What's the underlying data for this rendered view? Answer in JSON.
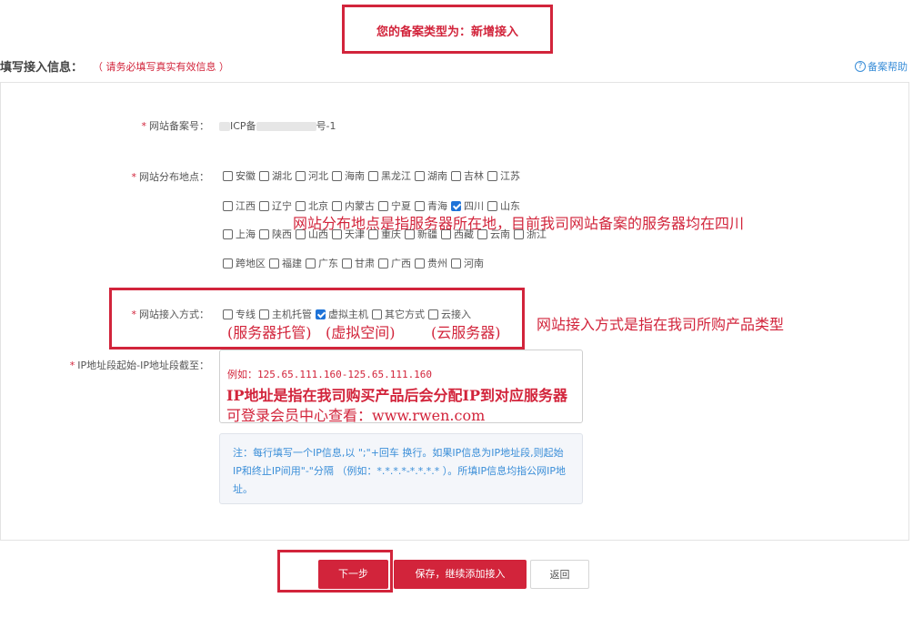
{
  "banner": {
    "type_text": "您的备案类型为：新增接入"
  },
  "section": {
    "title": "填写接入信息：",
    "note": "（ 请务必填写真实有效信息 ）",
    "help_label": "备案帮助",
    "help_icon": "?"
  },
  "form": {
    "record_number": {
      "label": "网站备案号：",
      "value_prefix": "ICP备",
      "value_suffix": "号-1"
    },
    "locations": {
      "label": "网站分布地点：",
      "rows": [
        [
          {
            "name": "安徽",
            "checked": false
          },
          {
            "name": "湖北",
            "checked": false
          },
          {
            "name": "河北",
            "checked": false
          },
          {
            "name": "海南",
            "checked": false
          },
          {
            "name": "黑龙江",
            "checked": false
          },
          {
            "name": "湖南",
            "checked": false
          },
          {
            "name": "吉林",
            "checked": false
          },
          {
            "name": "江苏",
            "checked": false
          }
        ],
        [
          {
            "name": "江西",
            "checked": false
          },
          {
            "name": "辽宁",
            "checked": false
          },
          {
            "name": "北京",
            "checked": false
          },
          {
            "name": "内蒙古",
            "checked": false
          },
          {
            "name": "宁夏",
            "checked": false
          },
          {
            "name": "青海",
            "checked": false
          },
          {
            "name": "四川",
            "checked": true
          },
          {
            "name": "山东",
            "checked": false
          }
        ],
        [
          {
            "name": "上海",
            "checked": false
          },
          {
            "name": "陕西",
            "checked": false
          },
          {
            "name": "山西",
            "checked": false
          },
          {
            "name": "天津",
            "checked": false
          },
          {
            "name": "重庆",
            "checked": false
          },
          {
            "name": "新疆",
            "checked": false
          },
          {
            "name": "西藏",
            "checked": false
          },
          {
            "name": "云南",
            "checked": false
          },
          {
            "name": "浙江",
            "checked": false
          }
        ],
        [
          {
            "name": "跨地区",
            "checked": false
          },
          {
            "name": "福建",
            "checked": false
          },
          {
            "name": "广东",
            "checked": false
          },
          {
            "name": "甘肃",
            "checked": false
          },
          {
            "name": "广西",
            "checked": false
          },
          {
            "name": "贵州",
            "checked": false
          },
          {
            "name": "河南",
            "checked": false
          }
        ]
      ],
      "annotation": "网站分布地点是指服务器所在地，目前我司网站备案的服务器均在四川"
    },
    "access_method": {
      "label": "网站接入方式：",
      "options": [
        {
          "name": "专线",
          "checked": false
        },
        {
          "name": "主机托管",
          "checked": false
        },
        {
          "name": "虚拟主机",
          "checked": true
        },
        {
          "name": "其它方式",
          "checked": false
        },
        {
          "name": "云接入",
          "checked": false
        }
      ],
      "sub_annotations": [
        "(服务器托管)",
        "(虚拟空间)",
        "(云服务器)"
      ],
      "annotation": "网站接入方式是指在我司所购产品类型"
    },
    "ip_range": {
      "label": "IP地址段起始-IP地址段截至：",
      "placeholder": "例如：125.65.111.160-125.65.111.160",
      "annotation_line1": "IP地址是指在我司购买产品后会分配IP到对应服务器",
      "annotation_line2": "可登录会员中心查看：www.rwen.com"
    },
    "note": "注：每行填写一个IP信息,以 \";\"+回车 换行。如果IP信息为IP地址段,则起始IP和终止IP间用\"-\"分隔 （例如：*.*.*.*-*.*.*.* ）。所填IP信息均指公网IP地址。"
  },
  "actions": {
    "next_label": "下一步",
    "save_label": "保存，继续添加接入",
    "back_label": "返回"
  }
}
